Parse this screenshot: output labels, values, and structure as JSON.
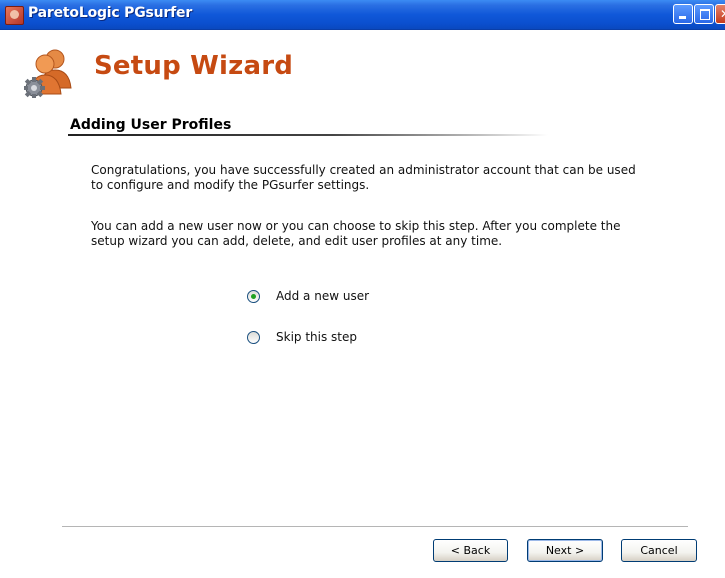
{
  "window": {
    "title": "ParetoLogic PGsurfer",
    "controls": [
      "minimize-icon",
      "maximize-icon",
      "close-icon"
    ]
  },
  "header": {
    "title": "Setup Wizard",
    "logo_icon": "users-gear-icon"
  },
  "section": {
    "title": "Adding User Profiles"
  },
  "body": {
    "paragraph1": "Congratulations, you have successfully created an administrator account that can be used to configure and modify the PGsurfer settings.",
    "paragraph2": "You can add a new user now or you can choose to skip this step.  After you complete the setup wizard you can add, delete, and edit user profiles at any time."
  },
  "options": [
    {
      "label": "Add a new user",
      "selected": true
    },
    {
      "label": "Skip this step",
      "selected": false
    }
  ],
  "buttons": {
    "back": "< Back",
    "next": "Next >",
    "cancel": "Cancel"
  },
  "colors": {
    "titlebar": "#0b4fcf",
    "wizard_title": "#c64a12",
    "radio_selected": "#21a121"
  }
}
